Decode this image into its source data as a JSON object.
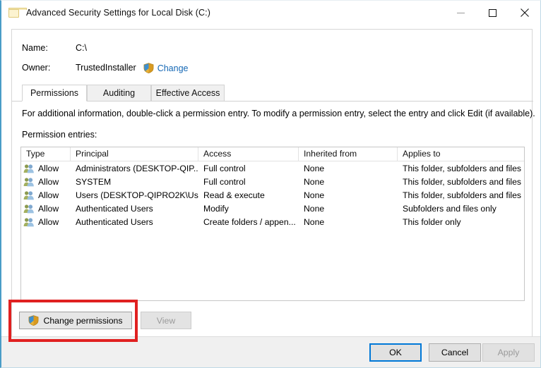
{
  "window": {
    "title": "Advanced Security Settings for Local Disk (C:)",
    "folder_icon": "folder-icon",
    "controls": [
      {
        "name": "minimize-button",
        "glyph": "minimize-icon"
      },
      {
        "name": "maximize-button",
        "glyph": "maximize-icon"
      },
      {
        "name": "close-button",
        "glyph": "close-icon"
      }
    ]
  },
  "info": {
    "name_label": "Name:",
    "name_value": "C:\\",
    "owner_label": "Owner:",
    "owner_value": "TrustedInstaller",
    "change_link": "Change",
    "change_shield_icon": "uac-shield-icon"
  },
  "tabs": [
    {
      "label": "Permissions",
      "active": true
    },
    {
      "label": "Auditing",
      "active": false
    },
    {
      "label": "Effective Access",
      "active": false
    }
  ],
  "body": {
    "info_text": "For additional information, double-click a permission entry. To modify a permission entry, select the entry and click Edit (if available).",
    "entries_label": "Permission entries:"
  },
  "table": {
    "columns": [
      "Type",
      "Principal",
      "Access",
      "Inherited from",
      "Applies to"
    ],
    "rows": [
      {
        "icon": "users-icon",
        "type": "Allow",
        "principal": "Administrators (DESKTOP-QIP...",
        "access": "Full control",
        "inherited_from": "None",
        "applies_to": "This folder, subfolders and files"
      },
      {
        "icon": "users-icon",
        "type": "Allow",
        "principal": "SYSTEM",
        "access": "Full control",
        "inherited_from": "None",
        "applies_to": "This folder, subfolders and files"
      },
      {
        "icon": "users-icon",
        "type": "Allow",
        "principal": "Users (DESKTOP-QIPRO2K\\Us...",
        "access": "Read & execute",
        "inherited_from": "None",
        "applies_to": "This folder, subfolders and files"
      },
      {
        "icon": "users-icon",
        "type": "Allow",
        "principal": "Authenticated Users",
        "access": "Modify",
        "inherited_from": "None",
        "applies_to": "Subfolders and files only"
      },
      {
        "icon": "users-icon",
        "type": "Allow",
        "principal": "Authenticated Users",
        "access": "Create folders / appen...",
        "inherited_from": "None",
        "applies_to": "This folder only"
      }
    ]
  },
  "actions": {
    "change_permissions": "Change permissions",
    "change_permissions_shield_icon": "uac-shield-icon",
    "view": "View",
    "view_disabled": true
  },
  "footer": {
    "ok": "OK",
    "cancel": "Cancel",
    "apply": "Apply",
    "apply_disabled": true
  },
  "annotation": {
    "highlight_color": "#e02020",
    "highlight_target": "Change permissions"
  },
  "colors": {
    "accent_border": "#4a9cc7",
    "link": "#1568b5",
    "focus_outline": "#0078d7",
    "disabled_text": "#9a9a9a"
  }
}
